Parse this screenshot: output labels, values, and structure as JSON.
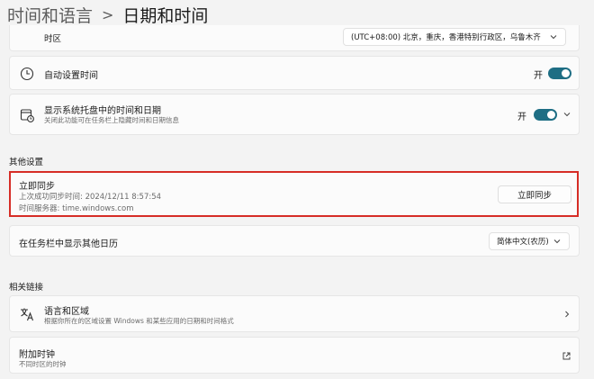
{
  "header": {
    "parent": "时间和语言",
    "separator": ">",
    "title": "日期和时间"
  },
  "timezone": {
    "label": "时区",
    "value": "(UTC+08:00) 北京，重庆，香港特别行政区，乌鲁木齐"
  },
  "auto_time": {
    "label": "自动设置时间",
    "state_text": "开",
    "on": true,
    "icon": "clock-icon"
  },
  "tray_time": {
    "label": "显示系统托盘中的时间和日期",
    "description": "关闭此功能可在任务栏上隐藏时间和日期信息",
    "state_text": "开",
    "on": true,
    "icon": "calendar-clock-icon"
  },
  "other_settings": {
    "title": "其他设置"
  },
  "sync": {
    "title": "立即同步",
    "last_sync": "上次成功同步时间: 2024/12/11 8:57:54",
    "server": "时间服务器: time.windows.com",
    "button": "立即同步",
    "highlight_color": "#d62d26"
  },
  "calendar": {
    "label": "在任务栏中显示其他日历",
    "value": "简体中文(农历)"
  },
  "related": {
    "title": "相关链接"
  },
  "language_region": {
    "title": "语言和区域",
    "description": "根据你所在的区域设置 Windows 和某些应用的日期和时间格式",
    "icon": "language-icon"
  },
  "extra_clocks": {
    "title": "附加时钟",
    "description": "不同时区的时钟"
  },
  "colors": {
    "accent": "#1e6e84",
    "background": "#f3f3f3",
    "card": "#fbfbfb"
  }
}
